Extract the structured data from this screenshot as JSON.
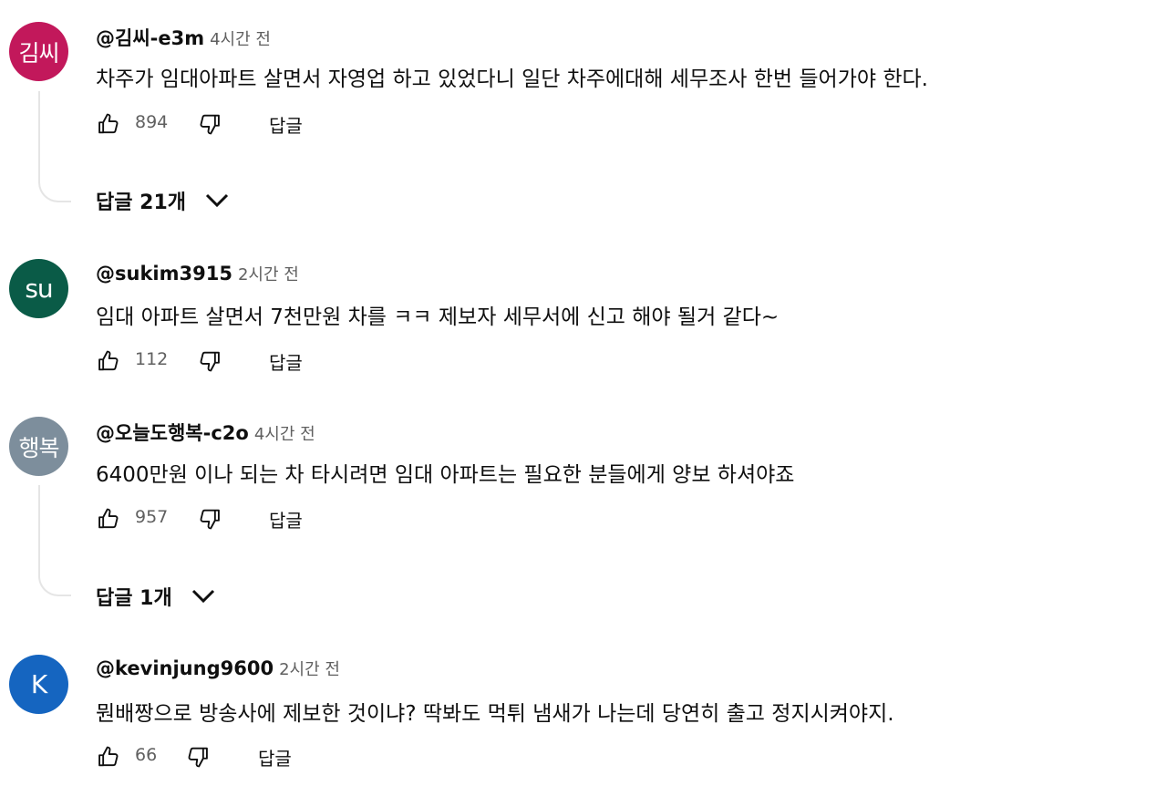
{
  "colors": {
    "avatar_1": "#c2185b",
    "avatar_2": "#0a5b47",
    "avatar_3": "#7d8e9c",
    "avatar_4": "#1565c0",
    "meta_text": "#606060",
    "thread_line": "#e5e5e5"
  },
  "icons": {
    "like": "thumbs-up-icon",
    "dislike": "thumbs-down-icon",
    "expand": "chevron-down-icon"
  },
  "comments": [
    {
      "avatar_text": "김씨",
      "author": "@김씨-e3m",
      "time": "4시간 전",
      "text": "차주가 임대아파트 살면서 자영업 하고 있었다니 일단 차주에대해 세무조사 한번 들어가야 한다.",
      "likes": "894",
      "reply_label": "답글",
      "replies_label": "답글 21개"
    },
    {
      "avatar_text": "su",
      "author": "@sukim3915",
      "time": "2시간 전",
      "text": "임대 아파트 살면서 7천만원 차를 ㅋㅋ  제보자 세무서에 신고 해야 될거 같다~",
      "likes": "112",
      "reply_label": "답글"
    },
    {
      "avatar_text": "행복",
      "author": "@오늘도행복-c2o",
      "time": "4시간 전",
      "text": "6400만원 이나 되는 차 타시려면 임대 아파트는 필요한 분들에게 양보 하셔야죠",
      "likes": "957",
      "reply_label": "답글",
      "replies_label": "답글 1개"
    },
    {
      "avatar_text": "K",
      "author": "@kevinjung9600",
      "time": "2시간 전",
      "text": "뭔배짱으로 방송사에 제보한 것이냐? 딱봐도 먹튀 냄새가 나는데 당연히 출고 정지시켜야지.",
      "likes": "66",
      "reply_label": "답글"
    }
  ]
}
